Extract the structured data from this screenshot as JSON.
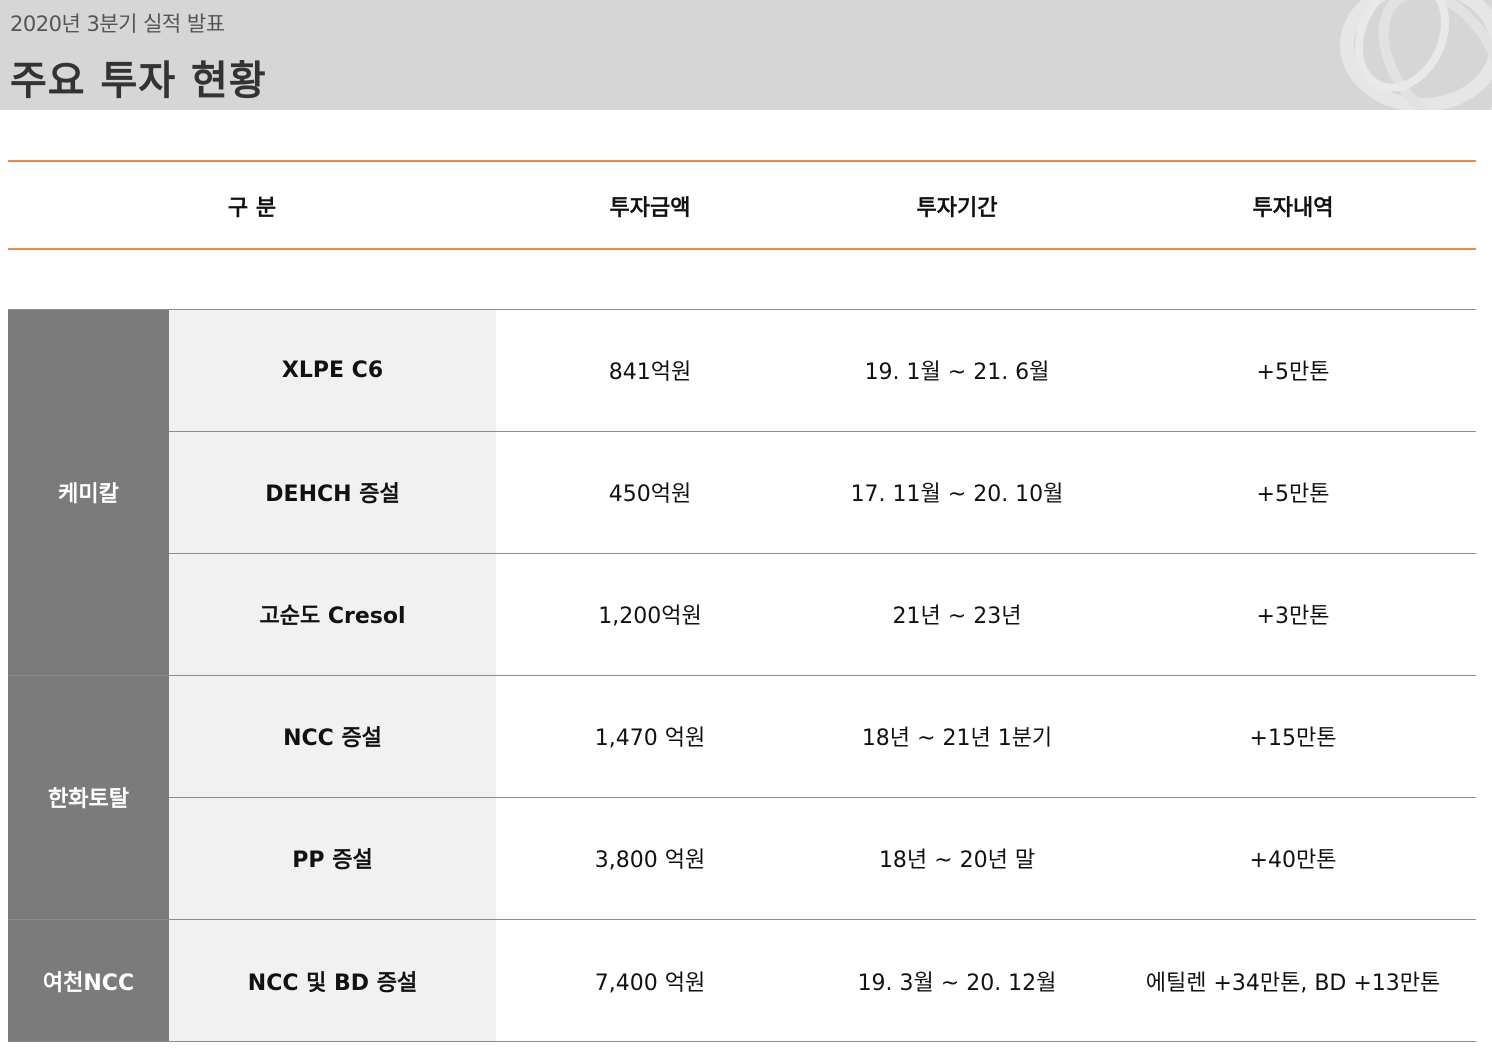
{
  "header": {
    "subtitle": "2020년 3분기 실적 발표",
    "title": "주요 투자 현황"
  },
  "columns": [
    "구 분",
    "투자금액",
    "투자기간",
    "투자내역"
  ],
  "groups": [
    {
      "company": "케미칼",
      "rows": [
        {
          "item": "XLPE C6",
          "amount": "841억원",
          "period": "19. 1월 ~ 21. 6월",
          "detail": "+5만톤"
        },
        {
          "item": "DEHCH 증설",
          "amount": "450억원",
          "period": "17. 11월 ~ 20. 10월",
          "detail": "+5만톤"
        },
        {
          "item": "고순도 Cresol",
          "amount": "1,200억원",
          "period": "21년 ~ 23년",
          "detail": "+3만톤"
        }
      ]
    },
    {
      "company": "한화토탈",
      "rows": [
        {
          "item": "NCC 증설",
          "amount": "1,470 억원",
          "period": "18년 ~ 21년 1분기",
          "detail": "+15만톤"
        },
        {
          "item": "PP 증설",
          "amount": "3,800 억원",
          "period": "18년 ~ 20년 말",
          "detail": "+40만톤"
        }
      ]
    },
    {
      "company": "여천NCC",
      "rows": [
        {
          "item": "NCC 및 BD 증설",
          "amount": "7,400 억원",
          "period": "19. 3월 ~ 20. 12월",
          "detail": "에틸렌 +34만톤, BD +13만톤"
        }
      ]
    }
  ],
  "colors": {
    "accent_rule": "#f08a4b",
    "company_cell": "#7b7b7b",
    "item_cell": "#f1f1f1",
    "header_band": "#d6d6d6"
  }
}
